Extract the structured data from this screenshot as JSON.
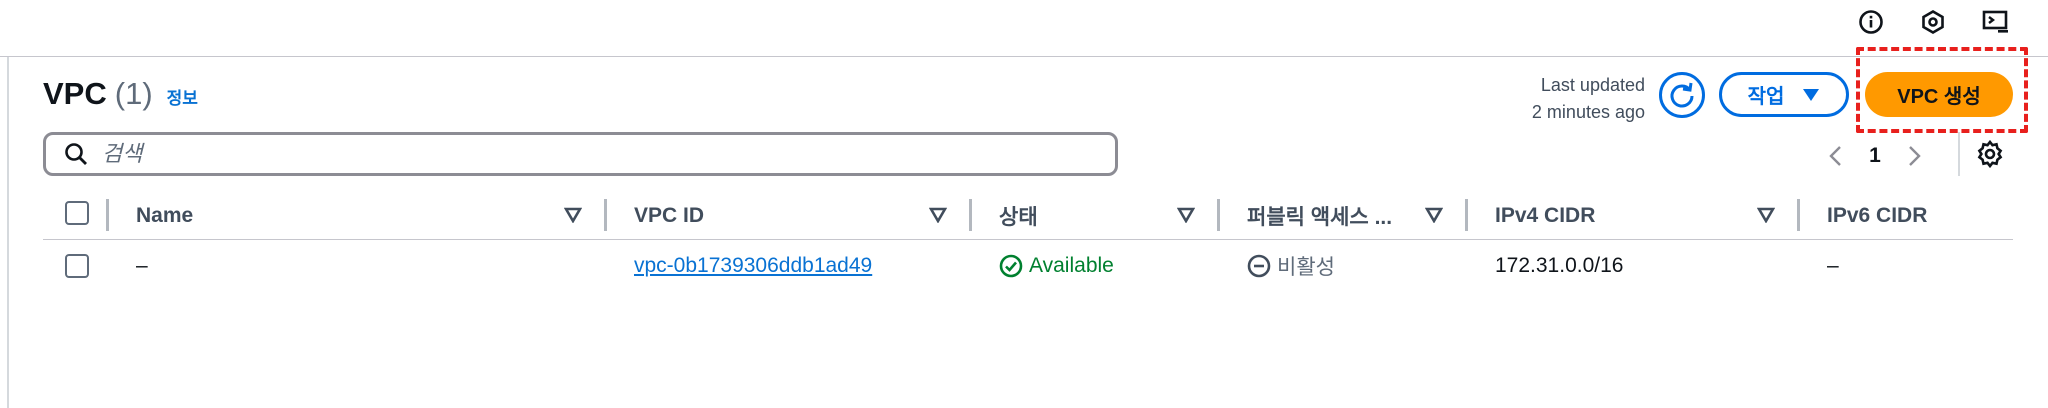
{
  "header": {
    "title": "VPC",
    "count": "(1)",
    "info_link": "정보",
    "last_updated_label": "Last updated",
    "last_updated_value": "2 minutes ago",
    "actions_label": "작업",
    "create_label": "VPC 생성"
  },
  "search": {
    "placeholder": "검색"
  },
  "pagination": {
    "current_page": "1"
  },
  "table": {
    "columns": [
      {
        "label": "Name"
      },
      {
        "label": "VPC ID"
      },
      {
        "label": "상태"
      },
      {
        "label": "퍼블릭 액세스 ..."
      },
      {
        "label": "IPv4 CIDR"
      },
      {
        "label": "IPv6 CIDR"
      }
    ],
    "rows": [
      {
        "name": "–",
        "vpc_id": "vpc-0b1739306ddb1ad49",
        "status": "Available",
        "public_access": "비활성",
        "ipv4_cidr": "172.31.0.0/16",
        "ipv6_cidr": "–"
      }
    ]
  },
  "icons": [
    "info-icon",
    "notifications-icon",
    "cloudshell-icon",
    "search-icon",
    "refresh-icon",
    "caret-down-icon",
    "chevron-left-icon",
    "chevron-right-icon",
    "settings-icon",
    "sort-icon",
    "status-success-icon",
    "status-disabled-icon"
  ],
  "colors": {
    "primary": "#006ce0",
    "link": "#0972d3",
    "create_button": "#ff9900",
    "success": "#00802f",
    "highlight": "#e8201d"
  }
}
